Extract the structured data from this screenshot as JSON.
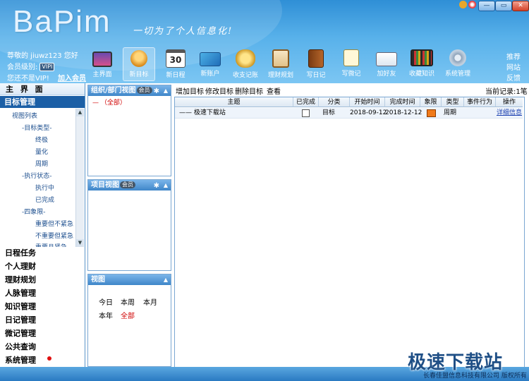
{
  "app": {
    "logo": "BaPim",
    "slogan": "一切为了个人信息化!"
  },
  "window_controls": {
    "minimize": "—",
    "restore": "▭",
    "close": "✕"
  },
  "user": {
    "greeting": "尊敬的 jiuwz123 您好",
    "level_label": "会员级别:",
    "level_badge": "VIPI",
    "not_vip": "您还不是VIP!",
    "join": "加入会员"
  },
  "toolbar": {
    "items": [
      {
        "label": "主界面",
        "icon": "monitor-icon"
      },
      {
        "label": "新目标",
        "icon": "medal-icon"
      },
      {
        "label": "新日程",
        "icon": "calendar-icon"
      },
      {
        "label": "新账户",
        "icon": "card-icon"
      },
      {
        "label": "收支记账",
        "icon": "coins-icon"
      },
      {
        "label": "理财规划",
        "icon": "clipboard-icon"
      },
      {
        "label": "写日记",
        "icon": "book-icon"
      },
      {
        "label": "写微记",
        "icon": "note-pen-icon"
      },
      {
        "label": "加好友",
        "icon": "friend-card-icon"
      },
      {
        "label": "收藏知识",
        "icon": "bookshelf-icon"
      },
      {
        "label": "系统管理",
        "icon": "gear-icon"
      }
    ],
    "calendar_day": "30",
    "right_links": [
      "推荐",
      "网站",
      "反馈"
    ]
  },
  "left_nav": {
    "main": "主 界 面",
    "target": "目标管理",
    "tree": [
      "视图列表",
      "-目标类型-",
      "终极",
      "量化",
      "周期",
      "-执行状态-",
      "执行中",
      "已完成",
      "-四象限-",
      "重要但不紧急",
      "不重要但紧急",
      "重要且紧急"
    ],
    "items": [
      "日程任务",
      "个人理财",
      "理财规划",
      "人脉管理",
      "知识管理",
      "日记管理",
      "微记管理",
      "公共查询",
      "系统管理"
    ]
  },
  "panels": {
    "org": {
      "title": "组织/部门视图",
      "badge": "会员",
      "tree_item": "（全部）"
    },
    "project": {
      "title": "项目视图",
      "badge": "会员"
    },
    "view": {
      "title": "视图",
      "items": [
        "今日",
        "本周",
        "本月",
        "本年",
        "全部"
      ]
    }
  },
  "main": {
    "toolbar": [
      "增加目标",
      "修改目标",
      "删除目标",
      "查看"
    ],
    "record_label": "当前记录:1笔",
    "columns": [
      "主题",
      "已完成",
      "分类",
      "开始时间",
      "完成时间",
      "象限",
      "类型",
      "事件行为",
      "操作"
    ],
    "rows": [
      {
        "subject": "极速下载站",
        "completed": false,
        "category": "目标",
        "start": "2018-09-12",
        "end": "2018-12-12",
        "quadrant_color": "#f07a1a",
        "type": "周期",
        "behavior": "",
        "action": "详细信息"
      }
    ]
  },
  "footer": {
    "watermark": "极速下载站",
    "company": "长春佳盟信息科技有限公司 版权所有"
  }
}
